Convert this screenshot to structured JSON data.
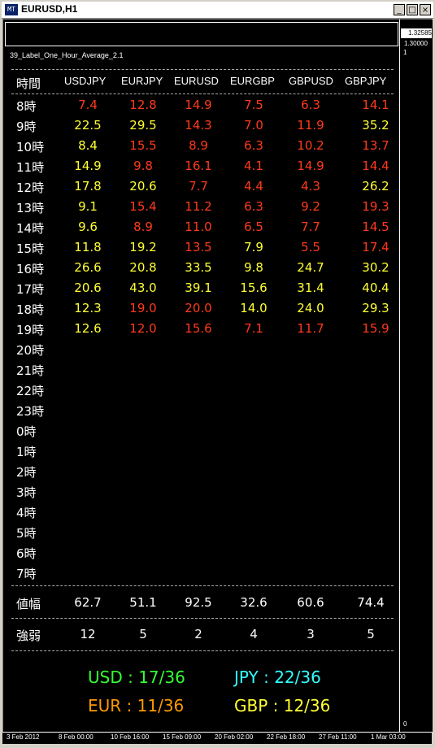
{
  "window": {
    "title": "EURUSD,H1",
    "min_label": "_",
    "max_label": "□",
    "close_label": "×",
    "icon_glyph": "MT"
  },
  "axis": {
    "price_top": "1.32585",
    "price_2": "1.30000",
    "label_1": "1",
    "label_0": "0"
  },
  "indicator": {
    "name": "39_Label_One_Hour_Average_2.1"
  },
  "colors": {
    "red": "#ff3a1a",
    "orange": "#ff7b1a",
    "yellow": "#ffff33",
    "white": "#ffffff",
    "green": "#33ff33",
    "cyan": "#33ffff",
    "amber": "#ff9900"
  },
  "table": {
    "corner": "時間",
    "columns": [
      "USDJPY",
      "EURJPY",
      "EURUSD",
      "EURGBP",
      "GBPUSD",
      "GBPJPY"
    ],
    "hours": [
      "8時",
      "9時",
      "10時",
      "11時",
      "12時",
      "13時",
      "14時",
      "15時",
      "16時",
      "17時",
      "18時",
      "19時",
      "20時",
      "21時",
      "22時",
      "23時",
      "0時",
      "1時",
      "2時",
      "3時",
      "4時",
      "5時",
      "6時",
      "7時"
    ],
    "rows": [
      [
        [
          "7.4",
          "red"
        ],
        [
          "12.8",
          "red"
        ],
        [
          "14.9",
          "red"
        ],
        [
          "7.5",
          "red"
        ],
        [
          "6.3",
          "red"
        ],
        [
          "14.1",
          "red"
        ]
      ],
      [
        [
          "22.5",
          "yellow"
        ],
        [
          "29.5",
          "yellow"
        ],
        [
          "14.3",
          "red"
        ],
        [
          "7.0",
          "red"
        ],
        [
          "11.9",
          "red"
        ],
        [
          "35.2",
          "yellow"
        ]
      ],
      [
        [
          "8.4",
          "yellow"
        ],
        [
          "15.5",
          "red"
        ],
        [
          "8.9",
          "red"
        ],
        [
          "6.3",
          "red"
        ],
        [
          "10.2",
          "red"
        ],
        [
          "13.7",
          "red"
        ]
      ],
      [
        [
          "14.9",
          "yellow"
        ],
        [
          "9.8",
          "red"
        ],
        [
          "16.1",
          "red"
        ],
        [
          "4.1",
          "red"
        ],
        [
          "14.9",
          "red"
        ],
        [
          "14.4",
          "red"
        ]
      ],
      [
        [
          "17.8",
          "yellow"
        ],
        [
          "20.6",
          "yellow"
        ],
        [
          "7.7",
          "red"
        ],
        [
          "4.4",
          "red"
        ],
        [
          "4.3",
          "red"
        ],
        [
          "26.2",
          "yellow"
        ]
      ],
      [
        [
          "9.1",
          "yellow"
        ],
        [
          "15.4",
          "red"
        ],
        [
          "11.2",
          "red"
        ],
        [
          "6.3",
          "red"
        ],
        [
          "9.2",
          "red"
        ],
        [
          "19.3",
          "red"
        ]
      ],
      [
        [
          "9.6",
          "yellow"
        ],
        [
          "8.9",
          "red"
        ],
        [
          "11.0",
          "red"
        ],
        [
          "6.5",
          "red"
        ],
        [
          "7.7",
          "red"
        ],
        [
          "14.5",
          "red"
        ]
      ],
      [
        [
          "11.8",
          "yellow"
        ],
        [
          "19.2",
          "yellow"
        ],
        [
          "13.5",
          "red"
        ],
        [
          "7.9",
          "yellow"
        ],
        [
          "5.5",
          "red"
        ],
        [
          "17.4",
          "red"
        ]
      ],
      [
        [
          "26.6",
          "yellow"
        ],
        [
          "20.8",
          "yellow"
        ],
        [
          "33.5",
          "yellow"
        ],
        [
          "9.8",
          "yellow"
        ],
        [
          "24.7",
          "yellow"
        ],
        [
          "30.2",
          "yellow"
        ]
      ],
      [
        [
          "20.6",
          "yellow"
        ],
        [
          "43.0",
          "yellow"
        ],
        [
          "39.1",
          "yellow"
        ],
        [
          "15.6",
          "yellow"
        ],
        [
          "31.4",
          "yellow"
        ],
        [
          "40.4",
          "yellow"
        ]
      ],
      [
        [
          "12.3",
          "yellow"
        ],
        [
          "19.0",
          "red"
        ],
        [
          "20.0",
          "red"
        ],
        [
          "14.0",
          "yellow"
        ],
        [
          "24.0",
          "yellow"
        ],
        [
          "29.3",
          "yellow"
        ]
      ],
      [
        [
          "12.6",
          "yellow"
        ],
        [
          "12.0",
          "red"
        ],
        [
          "15.6",
          "red"
        ],
        [
          "7.1",
          "red"
        ],
        [
          "11.7",
          "red"
        ],
        [
          "15.9",
          "red"
        ]
      ]
    ]
  },
  "footer": {
    "range_label": "値幅",
    "range_values": [
      "62.7",
      "51.1",
      "92.5",
      "32.6",
      "60.6",
      "74.4"
    ],
    "strength_label": "強弱",
    "strength_values": [
      "12",
      "5",
      "2",
      "4",
      "3",
      "5"
    ]
  },
  "strength": {
    "usd": "USD : 17/36",
    "jpy": "JPY : 22/36",
    "eur": "EUR : 11/36",
    "gbp": "GBP : 12/36"
  },
  "time_axis": [
    "3 Feb 2012",
    "8 Feb 00:00",
    "10 Feb 16:00",
    "15 Feb 09:00",
    "20 Feb 02:00",
    "22 Feb 18:00",
    "27 Feb 11:00",
    "1 Mar 03:00"
  ]
}
